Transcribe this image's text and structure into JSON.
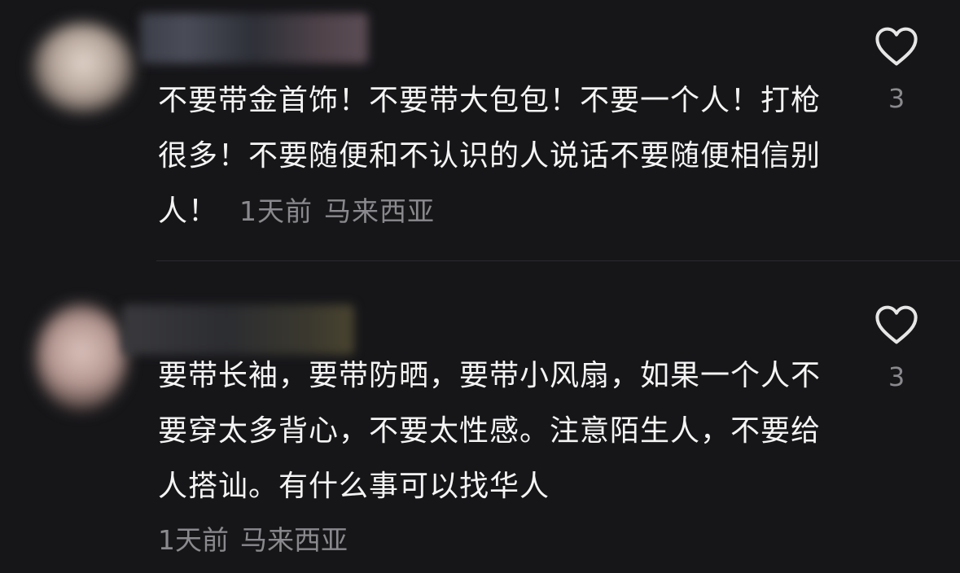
{
  "comments": [
    {
      "text": "不要带金首饰！不要带大包包！不要一个人！打枪很多！不要随便和不认识的人说话不要随便相信别人！",
      "time": "1天前",
      "location": "马来西亚",
      "likes": "3",
      "avatar": "blurred",
      "username": "blurred"
    },
    {
      "text": "要带长袖，要带防晒，要带小风扇，如果一个人不要穿太多背心，不要太性感。注意陌生人，不要给人搭讪。有什么事可以找华人",
      "time": "1天前",
      "location": "马来西亚",
      "likes": "3",
      "avatar": "blurred",
      "username": "blurred"
    }
  ],
  "icons": {
    "like": "heart-outline-icon"
  },
  "colors": {
    "background": "#161619",
    "text": "#f4f4f4",
    "meta": "#8a8a8e",
    "icon": "#e6e6e6"
  }
}
